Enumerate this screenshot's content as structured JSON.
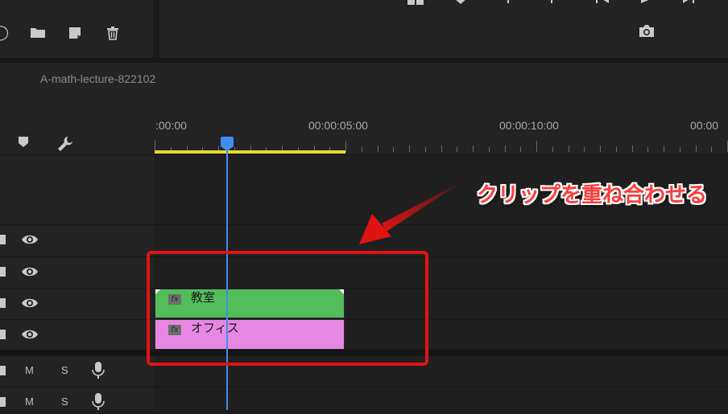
{
  "sequence": {
    "title": "A-math-lecture-822102"
  },
  "timecodes": [
    ":00:00",
    "00:00:05:00",
    "00:00:10:00",
    "00:00"
  ],
  "clips": [
    {
      "name": "教室",
      "fx": "fx",
      "color": "#52bd5a"
    },
    {
      "name": "オフィス",
      "fx": "fx",
      "color": "#e688e3"
    }
  ],
  "audio_tracks": [
    {
      "mute": "M",
      "solo": "S"
    },
    {
      "mute": "M",
      "solo": "S"
    }
  ],
  "annotation": {
    "text": "クリップを重ね合わせる",
    "color": "#e01313"
  },
  "colors": {
    "playhead": "#3d8ef0",
    "work_area": "#e3dc2f"
  },
  "icons": {
    "top_left": [
      "hide-icon",
      "folder-icon",
      "new-item-icon",
      "trash-icon"
    ],
    "top_right": [
      "overwrite-icon",
      "marker-icon",
      "mark-in-icon",
      "mark-out-icon",
      "go-to-in-icon",
      "play-icon",
      "step-forward-icon",
      "export-frame-icon"
    ],
    "timeline_tools": [
      "add-marker-icon",
      "wrench-icon"
    ]
  }
}
